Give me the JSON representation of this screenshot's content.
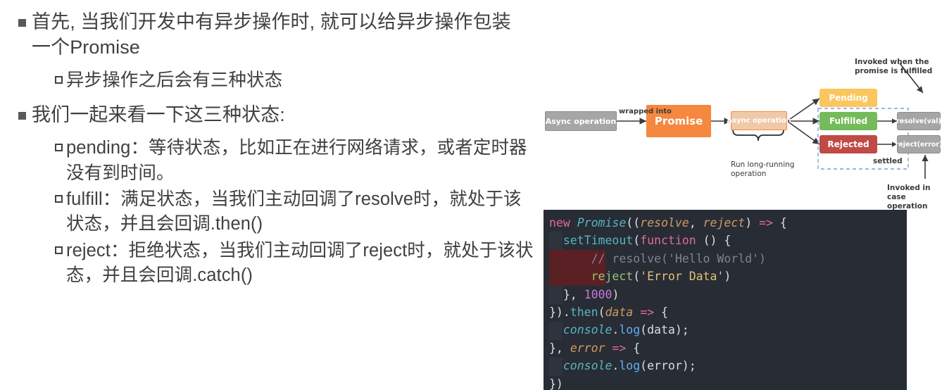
{
  "slide": {
    "bullets": [
      {
        "level": 1,
        "marker": "filled-square",
        "text": "首先, 当我们开发中有异步操作时, 就可以给异步操作包装一个Promise"
      },
      {
        "level": 2,
        "marker": "hollow-square",
        "text": "异步操作之后会有三种状态"
      },
      {
        "level": 1,
        "marker": "filled-square",
        "text": "我们一起来看一下这三种状态:"
      },
      {
        "level": 2,
        "marker": "hollow-square",
        "text": "pending：等待状态，比如正在进行网络请求，或者定时器没有到时间。"
      },
      {
        "level": 2,
        "marker": "hollow-square",
        "text": "fulfill：满足状态，当我们主动回调了resolve时，就处于该状态，并且会回调.then()"
      },
      {
        "level": 2,
        "marker": "hollow-square",
        "text": "reject：拒绝状态，当我们主动回调了reject时，就处于该状态，并且会回调.catch()"
      }
    ]
  },
  "diagram": {
    "boxes": {
      "async_operation_left": {
        "label": "Async operation",
        "fill": "#a6a6a6",
        "border": "#8c8c8c"
      },
      "promise": {
        "label": "Promise",
        "fill": "#f5873f",
        "border": "#f5873f"
      },
      "async_operation_inner": {
        "label": "Async operation",
        "fill": "#f0c9a8",
        "border": "#f5873f"
      },
      "pending": {
        "label": "Pending",
        "fill": "#fbc65e",
        "border": "#fbc65e"
      },
      "fulfilled": {
        "label": "Fulfilled",
        "fill": "#74bb5a",
        "border": "#74bb5a"
      },
      "rejected": {
        "label": "Rejected",
        "fill": "#c4ララ",
        "border": "#c04a45"
      },
      "resolve_val": {
        "label": "resolve(val)",
        "fill": "#a6a6a6",
        "border": "#8c8c8c"
      },
      "reject_error": {
        "label": "reject(error)",
        "fill": "#a6a6a6",
        "border": "#8c8c8c"
      }
    },
    "labels": {
      "wrapped_into": "wrapped into",
      "run_long_running": "Run long-running\noperation",
      "settled": "settled",
      "invoked_fulfilled": "Invoked when the\npromise is fulfilled",
      "invoked_failed": "Invoked in case\noperation fails"
    },
    "colors": {
      "pending": "#fbc65e",
      "fulfilled": "#74bb5a",
      "rejected": "#c04a45",
      "promise": "#f5873f",
      "grey": "#a6a6a6",
      "dashed": "#7b9fd4"
    }
  },
  "code": {
    "background": "#282c34",
    "lines": [
      "new Promise((resolve, reject) => {",
      "  setTimeout(function () {",
      "      // resolve('Hello World')",
      "      reject('Error Data')",
      "  }, 1000)",
      "}).then(data => {",
      "  console.log(data);",
      "}, error => {",
      "  console.log(error);",
      "})"
    ],
    "tokens": {
      "new": "new",
      "promise": "Promise",
      "resolve": "resolve",
      "reject": "reject",
      "arrow": "=>",
      "setTimeout": "setTimeout",
      "function": "function",
      "comment": "// resolve('Hello World')",
      "reject_call": "reject",
      "error_data": "'Error Data'",
      "timeout_ms": "1000",
      "then": "then",
      "data": "data",
      "console": "console",
      "log": "log",
      "error": "error"
    }
  }
}
